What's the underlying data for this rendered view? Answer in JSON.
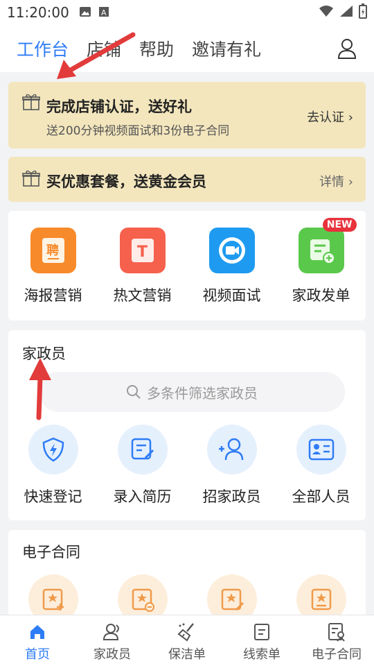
{
  "status_bar": {
    "time": "11:20:00"
  },
  "top_nav": {
    "tabs": [
      {
        "label": "工作台",
        "active": true
      },
      {
        "label": "店铺",
        "active": false
      },
      {
        "label": "帮助",
        "active": false
      },
      {
        "label": "邀请有礼",
        "active": false
      }
    ],
    "user_icon": "user-icon"
  },
  "banners": [
    {
      "title": "完成店铺认证，送好礼",
      "subtitle": "送200分钟视频面试和3份电子合同",
      "action": "去认证"
    },
    {
      "title": "买优惠套餐，送黄金会员",
      "action": "详情"
    }
  ],
  "tools": {
    "items": [
      {
        "label": "海报营销",
        "icon": "poster-icon",
        "color": "#f78a2a",
        "glyph": "聘"
      },
      {
        "label": "热文营销",
        "icon": "article-icon",
        "color": "#f5614d",
        "glyph": "T"
      },
      {
        "label": "视频面试",
        "icon": "video-icon",
        "color": "#1e9bf0"
      },
      {
        "label": "家政发单",
        "icon": "order-icon",
        "color": "#5ac84b",
        "badge": "NEW"
      }
    ]
  },
  "staff": {
    "title": "家政员",
    "search_placeholder": "多条件筛选家政员",
    "items": [
      {
        "label": "快速登记",
        "icon": "shield-bolt-icon"
      },
      {
        "label": "录入简历",
        "icon": "edit-doc-icon"
      },
      {
        "label": "招家政员",
        "icon": "add-person-icon"
      },
      {
        "label": "全部人员",
        "icon": "id-card-icon"
      }
    ]
  },
  "contract": {
    "title": "电子合同"
  },
  "bottom_nav": {
    "items": [
      {
        "label": "首页",
        "icon": "home-icon",
        "active": true
      },
      {
        "label": "家政员",
        "icon": "people-icon",
        "active": false
      },
      {
        "label": "保洁单",
        "icon": "broom-icon",
        "active": false
      },
      {
        "label": "线索单",
        "icon": "clue-icon",
        "active": false
      },
      {
        "label": "电子合同",
        "icon": "contract-icon",
        "active": false
      }
    ]
  },
  "colors": {
    "accent": "#2e7cf6",
    "banner_bg": "#f3e6bd",
    "arrow": "#e23b3b"
  }
}
